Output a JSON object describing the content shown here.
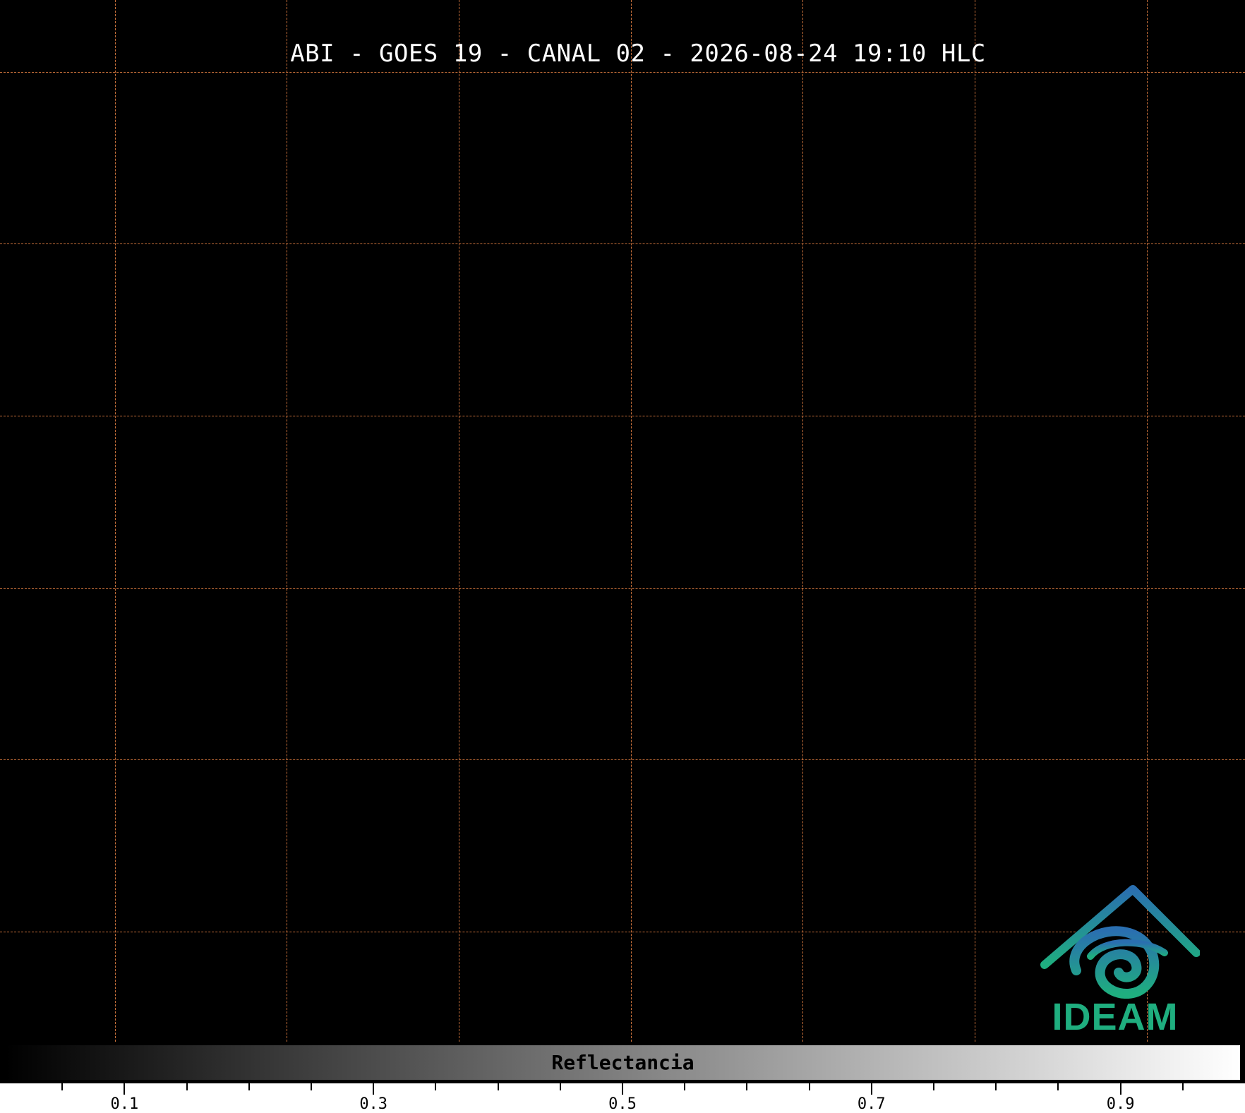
{
  "title": "ABI - GOES 19 - CANAL 02 - 2026-08-24 19:10 HLC",
  "colors": {
    "background": "#000000",
    "gridline": "#c8703a",
    "title_text": "#ffffff",
    "logo_teal": "#1fae7f",
    "logo_blue": "#2a6fb0"
  },
  "colorbar": {
    "label": "Reflectancia",
    "range": [
      0,
      1
    ],
    "gradient": [
      "#000000",
      "#ffffff"
    ],
    "tick_labels": [
      "0.1",
      "0.3",
      "0.5",
      "0.7",
      "0.9"
    ]
  },
  "logo": {
    "text": "IDEAM",
    "icon": "ideam-house-swirl-icon"
  }
}
